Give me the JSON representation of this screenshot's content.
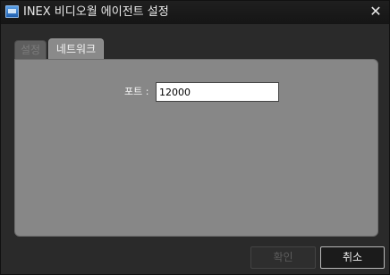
{
  "window": {
    "title": "INEX 비디오월 에이전트 설정",
    "app_icon": "monitor-icon",
    "close_icon": "close-icon",
    "close_glyph": "✕"
  },
  "tabs": [
    {
      "label": "설정",
      "active": false
    },
    {
      "label": "네트워크",
      "active": true
    }
  ],
  "network": {
    "port_label": "포트 :",
    "port_value": "12000"
  },
  "buttons": {
    "ok_label": "확인",
    "ok_enabled": false,
    "cancel_label": "취소"
  },
  "colors": {
    "background": "#2a2a2a",
    "panel": "#878787",
    "active_tab": "#8a8a8a"
  }
}
